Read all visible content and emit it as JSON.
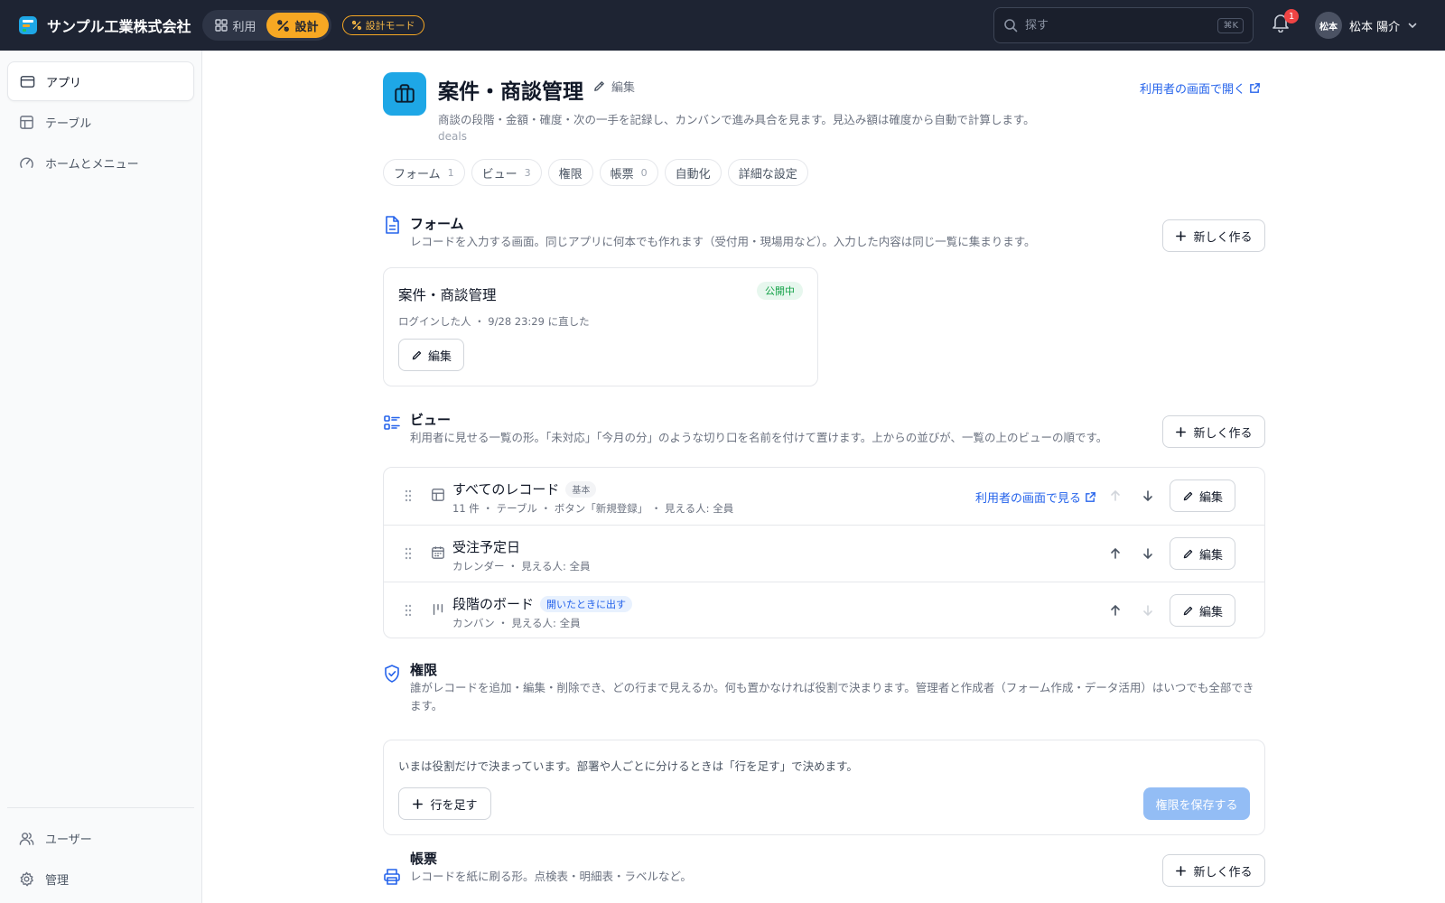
{
  "header": {
    "brand_name": "サンプル工業株式会社",
    "mode_use": "利用",
    "mode_design": "設計",
    "mode_badge": "設計モード",
    "search_placeholder": "探す",
    "search_shortcut": "⌘K",
    "notification_count": "1",
    "user_initials": "松本",
    "user_name": "松本 陽介"
  },
  "sidebar": {
    "items": [
      {
        "label": "アプリ",
        "icon": "app-window-icon"
      },
      {
        "label": "テーブル",
        "icon": "table-icon"
      },
      {
        "label": "ホームとメニュー",
        "icon": "gauge-icon"
      }
    ],
    "bottom_items": [
      {
        "label": "ユーザー",
        "icon": "users-icon"
      },
      {
        "label": "管理",
        "icon": "gear-icon"
      }
    ]
  },
  "app": {
    "title": "案件・商談管理",
    "edit_label": "編集",
    "open_user_label": "利用者の画面で開く",
    "description": "商談の段階・金額・確度・次の一手を記録し、カンバンで進み具合を見ます。見込み額は確度から自動で計算します。",
    "key": "deals",
    "tabs": [
      {
        "label": "フォーム",
        "count": "1"
      },
      {
        "label": "ビュー",
        "count": "3"
      },
      {
        "label": "権限",
        "count": ""
      },
      {
        "label": "帳票",
        "count": "0"
      },
      {
        "label": "自動化",
        "count": ""
      },
      {
        "label": "詳細な設定",
        "count": ""
      }
    ]
  },
  "form_section": {
    "title": "フォーム",
    "description": "レコードを入力する画面。同じアプリに何本でも作れます（受付用・現場用など）。入力した内容は同じ一覧に集まります。",
    "new_label": "新しく作る",
    "card": {
      "title": "案件・商談管理",
      "status": "公開中",
      "meta": "ログインした人 ・ 9/28 23:29 に直した",
      "edit_label": "編集"
    }
  },
  "view_section": {
    "title": "ビュー",
    "description": "利用者に見せる一覧の形。「未対応」「今月の分」のような切り口を名前を付けて置けます。上からの並びが、一覧の上のビューの順です。",
    "new_label": "新しく作る",
    "open_label": "利用者の画面で見る",
    "edit_label": "編集",
    "rows": [
      {
        "name": "すべてのレコード",
        "tag": "基本",
        "meta": "11 件 ・ テーブル ・ ボタン「新規登録」 ・ 見える人: 全員",
        "icon": "table-icon"
      },
      {
        "name": "受注予定日",
        "tag": "",
        "meta": "カレンダー ・ 見える人: 全員",
        "icon": "calendar-icon"
      },
      {
        "name": "段階のボード",
        "tag": "開いたときに出す",
        "meta": "カンバン ・ 見える人: 全員",
        "icon": "kanban-icon"
      }
    ]
  },
  "perm_section": {
    "title": "権限",
    "description": "誰がレコードを追加・編集・削除でき、どの行まで見えるか。何も置かなければ役割で決まります。管理者と作成者（フォーム作成・データ活用）はいつでも全部できます。",
    "status_text": "いまは役割だけで決まっています。部署や人ごとに分けるときは「行を足す」で決めます。",
    "add_row_label": "行を足す",
    "save_label": "権限を保存する"
  },
  "report_section": {
    "title": "帳票",
    "description": "レコードを紙に刷る形。点検表・明細表・ラベルなど。",
    "new_label": "新しく作る"
  }
}
